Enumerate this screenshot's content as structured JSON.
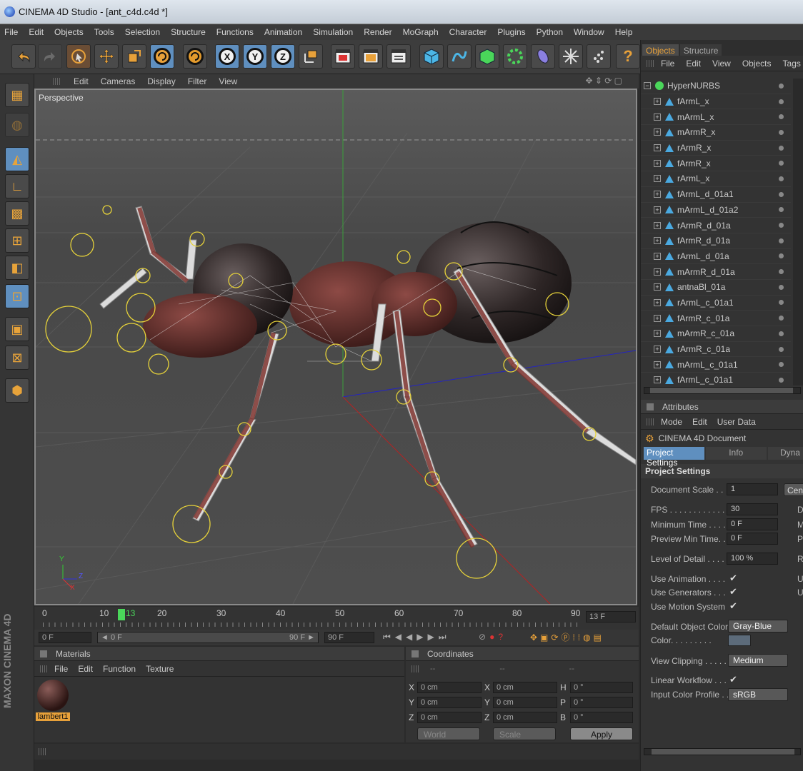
{
  "window": {
    "title": "CINEMA 4D Studio - [ant_c4d.c4d *]"
  },
  "menu": [
    "File",
    "Edit",
    "Objects",
    "Tools",
    "Selection",
    "Structure",
    "Functions",
    "Animation",
    "Simulation",
    "Render",
    "MoGraph",
    "Character",
    "Plugins",
    "Python",
    "Window",
    "Help"
  ],
  "toolbar": {
    "x_label": "X",
    "y_label": "Y",
    "z_label": "Z",
    "help_label": "?"
  },
  "viewport": {
    "menu": [
      "Edit",
      "Cameras",
      "Display",
      "Filter",
      "View"
    ],
    "label": "Perspective",
    "axis_y": "Y",
    "axis_z": "Z",
    "axis_x": "X"
  },
  "timeline": {
    "ticks": [
      "0",
      "10",
      "13",
      "20",
      "30",
      "40",
      "50",
      "60",
      "70",
      "80",
      "90"
    ],
    "current_frame": "13 F",
    "start_field": "0 F",
    "range_start": "◄ 0 F",
    "range_end": "90 F ►",
    "end_field": "90 F"
  },
  "materials": {
    "title": "Materials",
    "menu": [
      "File",
      "Edit",
      "Function",
      "Texture"
    ],
    "items": [
      "lambert1"
    ]
  },
  "coordinates": {
    "title": "Coordinates",
    "col_headers": [
      "--",
      "--",
      "--"
    ],
    "rows": [
      {
        "a": "X",
        "av": "0 cm",
        "b": "X",
        "bv": "0 cm",
        "c": "H",
        "cv": "0 °"
      },
      {
        "a": "Y",
        "av": "0 cm",
        "b": "Y",
        "bv": "0 cm",
        "c": "P",
        "cv": "0 °"
      },
      {
        "a": "Z",
        "av": "0 cm",
        "b": "Z",
        "bv": "0 cm",
        "c": "B",
        "cv": "0 °"
      }
    ],
    "world": "World",
    "scale": "Scale",
    "apply": "Apply"
  },
  "object_manager": {
    "tabs": [
      "Objects",
      "Structure"
    ],
    "menu": [
      "File",
      "Edit",
      "View",
      "Objects",
      "Tags"
    ],
    "root": "HyperNURBS",
    "items": [
      "fArmL_x",
      "mArmL_x",
      "mArmR_x",
      "rArmR_x",
      "fArmR_x",
      "rArmL_x",
      "fArmL_d_01a1",
      "mArmL_d_01a2",
      "rArmR_d_01a",
      "fArmR_d_01a",
      "rArmL_d_01a",
      "mArmR_d_01a",
      "antnaBl_01a",
      "rArmL_c_01a1",
      "fArmR_c_01a",
      "mArmR_c_01a",
      "rArmR_c_01a",
      "mArmL_c_01a1",
      "fArmL_c_01a1"
    ]
  },
  "attributes": {
    "title": "Attributes",
    "menu": [
      "Mode",
      "Edit",
      "User Data"
    ],
    "doc_name": "CINEMA 4D Document",
    "tabs": [
      "Project Settings",
      "Info",
      "Dyna"
    ],
    "section": "Project Settings",
    "document_scale_label": "Document Scale . .",
    "document_scale": "1",
    "cen_btn": "Cen",
    "fps_label": "FPS . . . . . . . . . . . .",
    "fps": "30",
    "min_time_label": "Minimum Time . . . .",
    "min_time": "0 F",
    "preview_min_label": "Preview Min Time. .",
    "preview_min": "0 F",
    "lod_label": "Level of Detail . . . .",
    "lod": "100 %",
    "use_anim_label": "Use Animation . . . .",
    "use_gen_label": "Use Generators . . .",
    "use_motion_label": "Use Motion System",
    "check": "✔",
    "obj_color_label": "Default Object Color",
    "obj_color": "Gray-Blue",
    "color_label": "Color. . . . . . . . .",
    "view_clip_label": "View Clipping . . . . .",
    "view_clip": "Medium",
    "linear_label": "Linear Workflow . . .",
    "input_profile_label": "Input Color Profile . .",
    "input_profile": "sRGB",
    "right_letters": [
      "D",
      "M",
      "P",
      "R",
      "U",
      "U"
    ]
  },
  "brand": "MAXON CINEMA 4D",
  "colors": {
    "accent": "#e8a13a",
    "selection_blue": "#5f8fbf",
    "joint_blue": "#4aa9e0"
  }
}
